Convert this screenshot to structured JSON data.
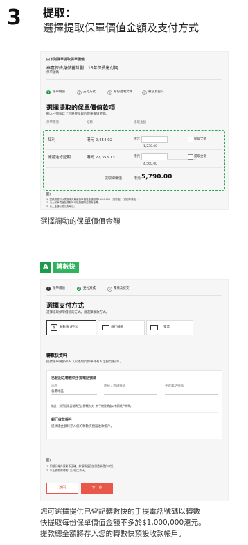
{
  "step": {
    "number": "3",
    "title": "提取：",
    "subtitle": "選擇提取保單價值金額及支付方式"
  },
  "shot1": {
    "section": "由下列保單提取保單價值",
    "plan": "泰嘉保終身儲蓄計劃，15年保費繳付期",
    "plan_sub": "保單號碼",
    "steps": [
      "保單價值",
      "支付方式",
      "身份證明文件",
      "覆核及提交"
    ],
    "heading": "選擇提取的保單價值款項",
    "instruction": "輸入一個或以上您將要提取的保單價值金額。",
    "columns": [
      "保單價值",
      "結餘",
      "提取金額"
    ],
    "rows": [
      {
        "name": "紅利",
        "balance": "港元 2,454.02",
        "currency": "港元",
        "amount": "1,230.00",
        "full": "提取全數"
      },
      {
        "name": "儲蓄進修延期",
        "balance": "港元 22,353.13",
        "currency": "港元",
        "amount": "4,560.00",
        "full": "提取全數"
      }
    ],
    "total_label": "提取總價值",
    "total_currency": "港元",
    "total_value": "5,790.00",
    "notes_title": "註：",
    "notes": [
      "1. 提款期間可以提取總共最高保單價值金額港幣1,000,000（港幣值）（或相等價值）。",
      "2. 以上保單價值在提取時可能與實際金額有差異。",
      "3. 以上金額以港元為單位。"
    ]
  },
  "caption1": "選擇調動的保單價值金額",
  "tag": {
    "letter": "A",
    "text": "轉數快"
  },
  "shot2": {
    "steps": [
      "保單價值",
      "支付方式",
      "覆核及提交"
    ],
    "heading": "選擇支付方式",
    "instruction": "選擇提取保單價值的方式。請選擇收款方式。",
    "options": [
      {
        "label": "轉數快 (FPS)"
      },
      {
        "label": "銀行轉帳"
      },
      {
        "label": "支票"
      }
    ],
    "fps_title": "轉數快資料",
    "fps_desc": "提款保單將會存入（只適用於保單持有人之銀行帳戶）。",
    "reg_title": "已登記之轉數快手提電話號碼",
    "fields": [
      {
        "label": "地區",
        "value": "香港地區"
      },
      {
        "label": "區號 / 區域號碼",
        "value": "-"
      },
      {
        "label": "手提電話號碼",
        "value": "-"
      }
    ],
    "hint": "備註：如手提電話號碼已註冊轉數快，有手機號碼會以有關帳戶為準。",
    "acct_title": "銀行收款帳戶",
    "acct_desc": "提款總金額將存入您的轉數快預設收款帳戶。",
    "notes_title": "註：",
    "notes": [
      "1. 如銀行帳戶資料不正確，款項將退回並需重新提交申請。",
      "2. 以上提款需時約1至2個工作天。"
    ],
    "back": "返回",
    "next": "下一步"
  },
  "caption2": [
    "您可選擇提供已登記轉數快的手提電話號碼以轉數",
    "快提取每份保單價值金額不多於$1,000,000港元。",
    "提款總金額將存入您的轉數快預設收款帳戶。"
  ],
  "colors": {
    "accent": "#2aa35a",
    "cta": "#e8574a",
    "step_active": "#1e9a4b"
  }
}
